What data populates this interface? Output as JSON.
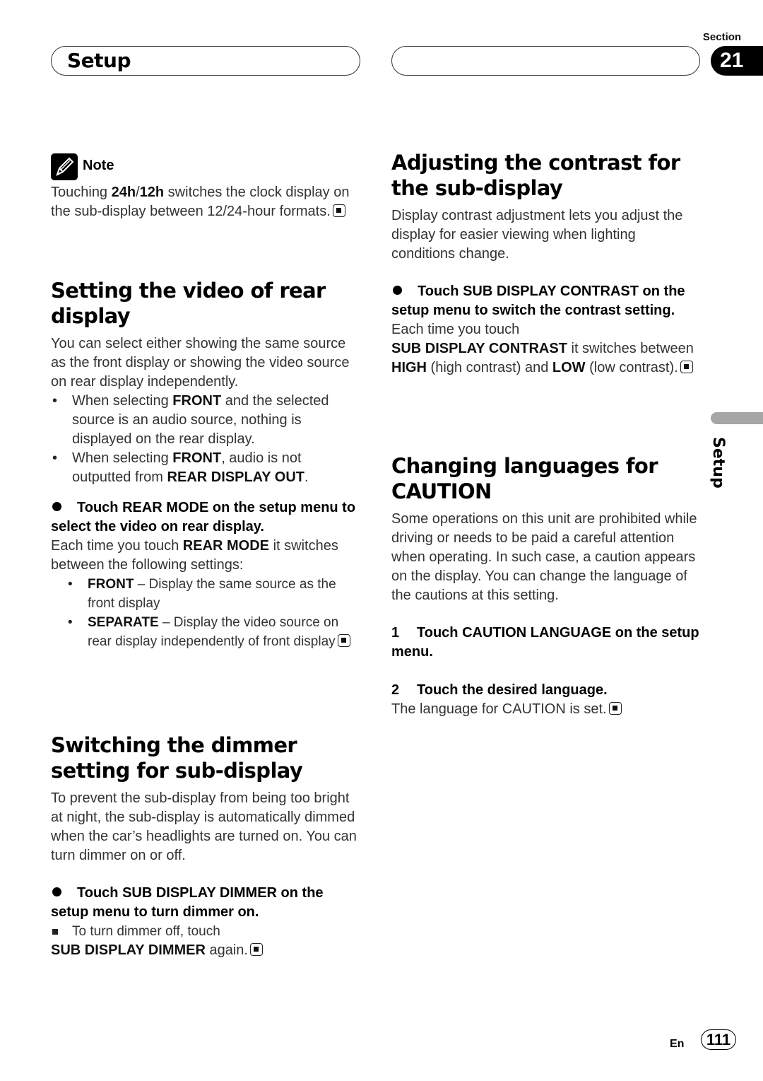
{
  "header": {
    "title": "Setup",
    "section_label": "Section",
    "section_number": "21"
  },
  "side_tab": {
    "label": "Setup"
  },
  "note": {
    "label": "Note",
    "icon": "pencil-icon",
    "text_before": "Touching ",
    "bold1": "24h",
    "slash": "/",
    "bold2": "12h",
    "text_after": " switches the clock display on the sub-display between 12/24-hour formats."
  },
  "rear_display": {
    "heading": "Setting the video of rear display",
    "intro": "You can select either showing the same source as the front display or showing the video source on rear display independently.",
    "bullets": [
      {
        "pre": "When selecting ",
        "bold": "FRONT",
        "post": " and the selected source is an audio source, nothing is displayed on the rear display."
      },
      {
        "pre": "When selecting ",
        "bold": "FRONT",
        "mid": ", audio is not outputted from ",
        "bold2": "REAR DISPLAY OUT",
        "post": "."
      }
    ],
    "step": "Touch REAR MODE on the setup menu to select the video on rear display.",
    "step_desc_pre": "Each time you touch ",
    "step_desc_bold": "REAR MODE",
    "step_desc_post": " it switches between the following settings:",
    "options": [
      {
        "name": "FRONT",
        "desc": " – Display the same source as the front display"
      },
      {
        "name": "SEPARATE",
        "desc": " – Display the video source on rear display independently of front display"
      }
    ]
  },
  "dimmer": {
    "heading": "Switching the dimmer setting for sub-display",
    "intro": "To prevent the sub-display from being too bright at night, the sub-display is automatically dimmed when the car’s headlights are turned on. You can turn dimmer on or off.",
    "step": "Touch SUB DISPLAY DIMMER on the setup menu to turn dimmer on.",
    "tip": "To turn dimmer off, touch",
    "tip_bold": "SUB DISPLAY DIMMER",
    "tip_post": " again."
  },
  "contrast": {
    "heading": "Adjusting the contrast for the sub-display",
    "intro": "Display contrast adjustment lets you adjust the display for easier viewing when lighting conditions change.",
    "step": "Touch SUB DISPLAY CONTRAST on the setup menu to switch the contrast setting.",
    "desc1": "Each time you touch",
    "desc_bold": "SUB DISPLAY CONTRAST",
    "desc2": " it switches between ",
    "high": "HIGH",
    "high_desc": " (high contrast) and ",
    "low": "LOW",
    "low_desc": " (low contrast)."
  },
  "caution": {
    "heading": "Changing languages for CAUTION",
    "intro": "Some operations on this unit are prohibited while driving or needs to be paid a careful attention when operating. In such case, a caution appears on the display. You can change the language of the cautions at this setting.",
    "steps": [
      {
        "num": "1",
        "text": "Touch CAUTION LANGUAGE on the setup menu."
      },
      {
        "num": "2",
        "text": "Touch the desired language."
      }
    ],
    "result": "The language for CAUTION is set."
  },
  "footer": {
    "lang": "En",
    "page": "111"
  }
}
